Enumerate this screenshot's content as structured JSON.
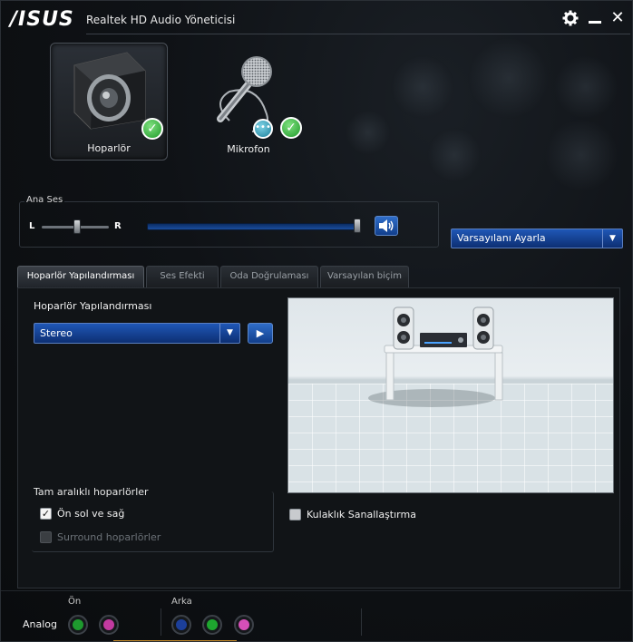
{
  "window": {
    "brand": "/ISUS",
    "title": "Realtek HD Audio Yöneticisi",
    "buttons": {
      "settings": "settings-icon",
      "minimize": "minimize-icon",
      "close": "close-icon"
    }
  },
  "devices": [
    {
      "label": "Hoparlör",
      "active": true,
      "icon": "speaker-icon",
      "status": "check"
    },
    {
      "label": "Mikrofon",
      "active": false,
      "icon": "microphone-icon",
      "status": "check"
    }
  ],
  "main_volume": {
    "title": "Ana Ses",
    "left_label": "L",
    "right_label": "R",
    "balance": 0.5,
    "volume": 1.0,
    "mute_icon": "speaker-volume-icon"
  },
  "default_device": {
    "label": "Varsayılanı Ayarla"
  },
  "tabs": [
    {
      "label": "Hoparlör Yapılandırması",
      "active": true
    },
    {
      "label": "Ses Efekti",
      "active": false
    },
    {
      "label": "Oda Doğrulaması",
      "active": false
    },
    {
      "label": "Varsayılan biçim",
      "active": false
    }
  ],
  "config": {
    "heading": "Hoparlör Yapılandırması",
    "mode_value": "Stereo",
    "play_icon": "play-icon"
  },
  "fullrange": {
    "title": "Tam aralıklı hoparlörler",
    "front": {
      "label": "Ön sol ve sağ",
      "checked": true,
      "enabled": true
    },
    "surround": {
      "label": "Surround hoparlörler",
      "checked": false,
      "enabled": false
    }
  },
  "headphone": {
    "label": "Kulaklık Sanallaştırma",
    "checked": false
  },
  "jacks": {
    "analog_label": "Analog",
    "front_label": "Ön",
    "back_label": "Arka",
    "front": [
      {
        "color": "#1e9a2e"
      },
      {
        "color": "#c23aa0"
      }
    ],
    "back": [
      {
        "color": "#1c3f9a"
      },
      {
        "color": "#1ea62f"
      },
      {
        "color": "#d64fb8"
      }
    ]
  }
}
